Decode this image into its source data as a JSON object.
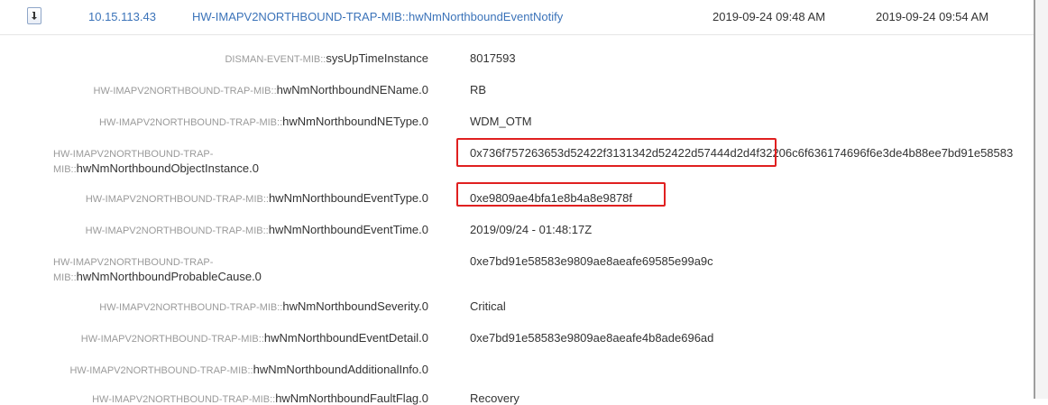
{
  "header": {
    "ip": "10.15.113.43",
    "trap_oid": "HW-IMAPV2NORTHBOUND-TRAP-MIB::hwNmNorthboundEventNotify",
    "time1": "2019-09-24 09:48 AM",
    "time2": "2019-09-24 09:54 AM"
  },
  "varbinds": [
    {
      "mib": "DISMAN-EVENT-MIB::",
      "name": "sysUpTimeInstance",
      "value": "8017593"
    },
    {
      "mib": "HW-IMAPV2NORTHBOUND-TRAP-MIB::",
      "name": "hwNmNorthboundNEName.0",
      "value": "RB"
    },
    {
      "mib": "HW-IMAPV2NORTHBOUND-TRAP-MIB::",
      "name": "hwNmNorthboundNEType.0",
      "value": "WDM_OTM"
    },
    {
      "mib": "HW-IMAPV2NORTHBOUND-TRAP-",
      "mib2": "MIB::",
      "name": "hwNmNorthboundObjectInstance.0",
      "value": "0x736f757263653d52422f3131342d52422d57444d2d4f32206c6f636174696f6e3de4b88ee7bd91e58583"
    },
    {
      "mib": "HW-IMAPV2NORTHBOUND-TRAP-MIB::",
      "name": "hwNmNorthboundEventType.0",
      "value": "0xe9809ae4bfa1e8b4a8e9878f"
    },
    {
      "mib": "HW-IMAPV2NORTHBOUND-TRAP-MIB::",
      "name": "hwNmNorthboundEventTime.0",
      "value": "2019/09/24 - 01:48:17Z"
    },
    {
      "mib": "HW-IMAPV2NORTHBOUND-TRAP-",
      "mib2": "MIB::",
      "name": "hwNmNorthboundProbableCause.0",
      "value": "0xe7bd91e58583e9809ae8aeafe69585e99a9c"
    },
    {
      "mib": "HW-IMAPV2NORTHBOUND-TRAP-MIB::",
      "name": "hwNmNorthboundSeverity.0",
      "value": "Critical"
    },
    {
      "mib": "HW-IMAPV2NORTHBOUND-TRAP-MIB::",
      "name": "hwNmNorthboundEventDetail.0",
      "value": "0xe7bd91e58583e9809ae8aeafe4b8ade696ad"
    },
    {
      "mib": "HW-IMAPV2NORTHBOUND-TRAP-MIB::",
      "name": "hwNmNorthboundAdditionalInfo.0",
      "value": ""
    },
    {
      "mib": "HW-IMAPV2NORTHBOUND-TRAP-MIB::",
      "name": "hwNmNorthboundFaultFlag.0",
      "value": "Recovery"
    }
  ],
  "icons": {
    "expand": "collapse-arrow-icon"
  },
  "colors": {
    "link": "#3b73b9",
    "highlight": "#e02020"
  }
}
